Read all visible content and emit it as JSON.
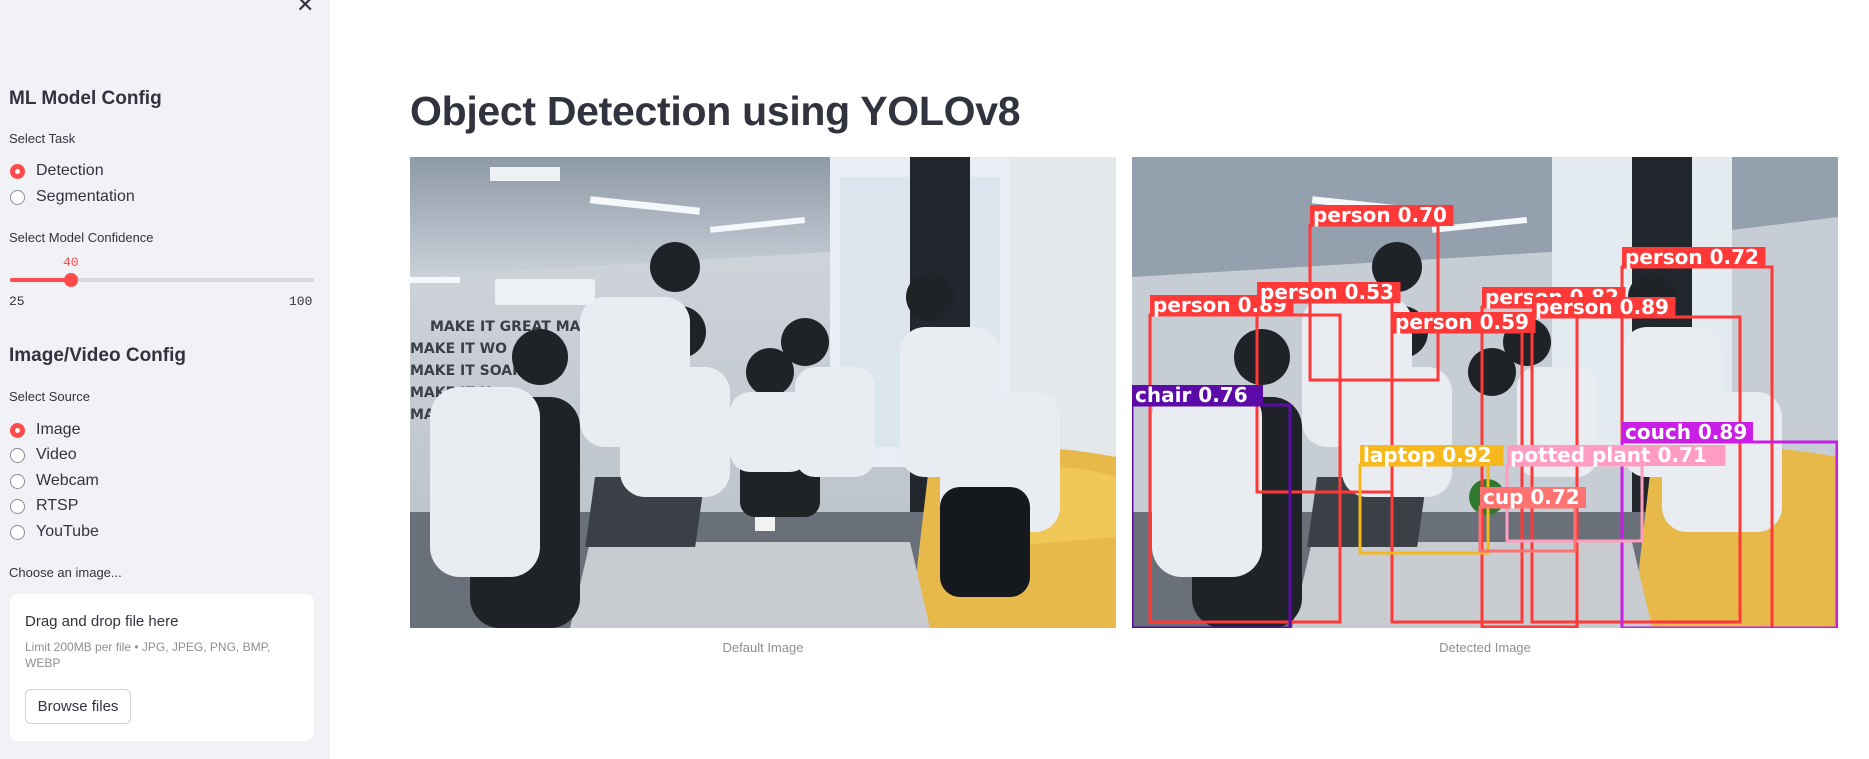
{
  "sidebar": {
    "model_config_title": "ML Model Config",
    "select_task_label": "Select Task",
    "task_options": [
      {
        "label": "Detection",
        "selected": true
      },
      {
        "label": "Segmentation",
        "selected": false
      }
    ],
    "confidence_label": "Select Model Confidence",
    "confidence": {
      "value": "40",
      "min": "25",
      "max": "100"
    },
    "io_config_title": "Image/Video Config",
    "select_source_label": "Select Source",
    "source_options": [
      {
        "label": "Image",
        "selected": true
      },
      {
        "label": "Video",
        "selected": false
      },
      {
        "label": "Webcam",
        "selected": false
      },
      {
        "label": "RTSP",
        "selected": false
      },
      {
        "label": "YouTube",
        "selected": false
      }
    ],
    "choose_image_label": "Choose an image...",
    "uploader": {
      "title": "Drag and drop file here",
      "note": "Limit 200MB per file • JPG, JPEG, PNG, BMP, WEBP",
      "button": "Browse files"
    }
  },
  "main": {
    "title": "Object Detection using YOLOv8",
    "default_caption": "Default Image",
    "detected_caption": "Detected Image",
    "wall_text": [
      "MAKE IT GREAT MAKE",
      "MAKE IT WO",
      "MAKE IT SOAR",
      "MAKE IT H",
      "MAKE IT BE"
    ]
  },
  "detections": [
    {
      "label": "person 0.70",
      "color": "#ff3838"
    },
    {
      "label": "person 0.72",
      "color": "#ff3838"
    },
    {
      "label": "person 0.89",
      "color": "#ff3838"
    },
    {
      "label": "person 0.53",
      "color": "#ff3838"
    },
    {
      "label": "person 0.82",
      "color": "#ff3838"
    },
    {
      "label": "person 0.89",
      "color": "#ff3838"
    },
    {
      "label": "person 0.59",
      "color": "#ff3838"
    },
    {
      "label": "chair 0.76",
      "color": "#5c0aa8"
    },
    {
      "label": "couch 0.89",
      "color": "#c81ee6"
    },
    {
      "label": "laptop 0.92",
      "color": "#f6b81c"
    },
    {
      "label": "potted plant 0.71",
      "color": "#ff9cc0"
    },
    {
      "label": "cup 0.72",
      "color": "#ff7272"
    }
  ]
}
